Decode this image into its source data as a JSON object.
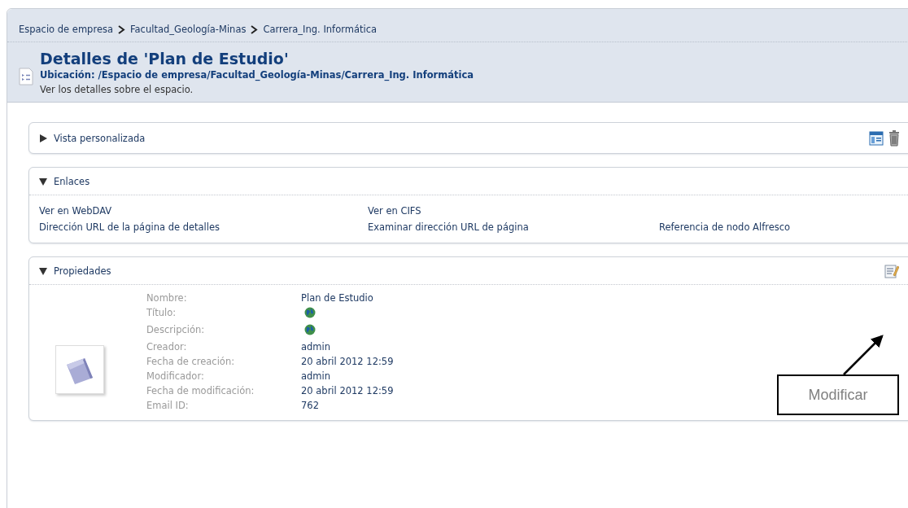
{
  "breadcrumb": [
    "Espacio de empresa",
    "Facultad_Geología-Minas",
    "Carrera_Ing. Informática"
  ],
  "header": {
    "title": "Detalles de 'Plan de Estudio'",
    "location": "Ubicación: /Espacio de empresa/Facultad_Geología-Minas/Carrera_Ing. Informática",
    "description": "Ver los detalles sobre el espacio."
  },
  "panels": [
    {
      "kind": "view",
      "title": "Vista personalizada",
      "expanded": false
    },
    {
      "kind": "links",
      "title": "Enlaces",
      "expanded": true,
      "links": [
        [
          "Ver en WebDAV",
          "Ver en CIFS"
        ],
        [
          "Dirección URL de la página de detalles",
          "Examinar dirección URL de página",
          "Referencia de nodo Alfresco"
        ]
      ]
    },
    {
      "kind": "properties",
      "title": "Propiedades",
      "expanded": true,
      "properties": [
        {
          "label": "Nombre:",
          "kind": "text",
          "value": "Plan de Estudio"
        },
        {
          "label": "Título:",
          "kind": "globe"
        },
        {
          "label": "Descripción:",
          "kind": "globe"
        },
        {
          "label": "Creador:",
          "kind": "text",
          "value": "admin"
        },
        {
          "label": "Fecha de creación:",
          "kind": "text",
          "value": "20 abril 2012 12:59"
        },
        {
          "label": "Modificador:",
          "kind": "text",
          "value": "admin"
        },
        {
          "label": "Fecha de modificación:",
          "kind": "text",
          "value": "20 abril 2012 12:59"
        },
        {
          "label": "Email ID:",
          "kind": "text",
          "value": "762"
        }
      ]
    }
  ],
  "callout": {
    "text": "Modificar"
  }
}
